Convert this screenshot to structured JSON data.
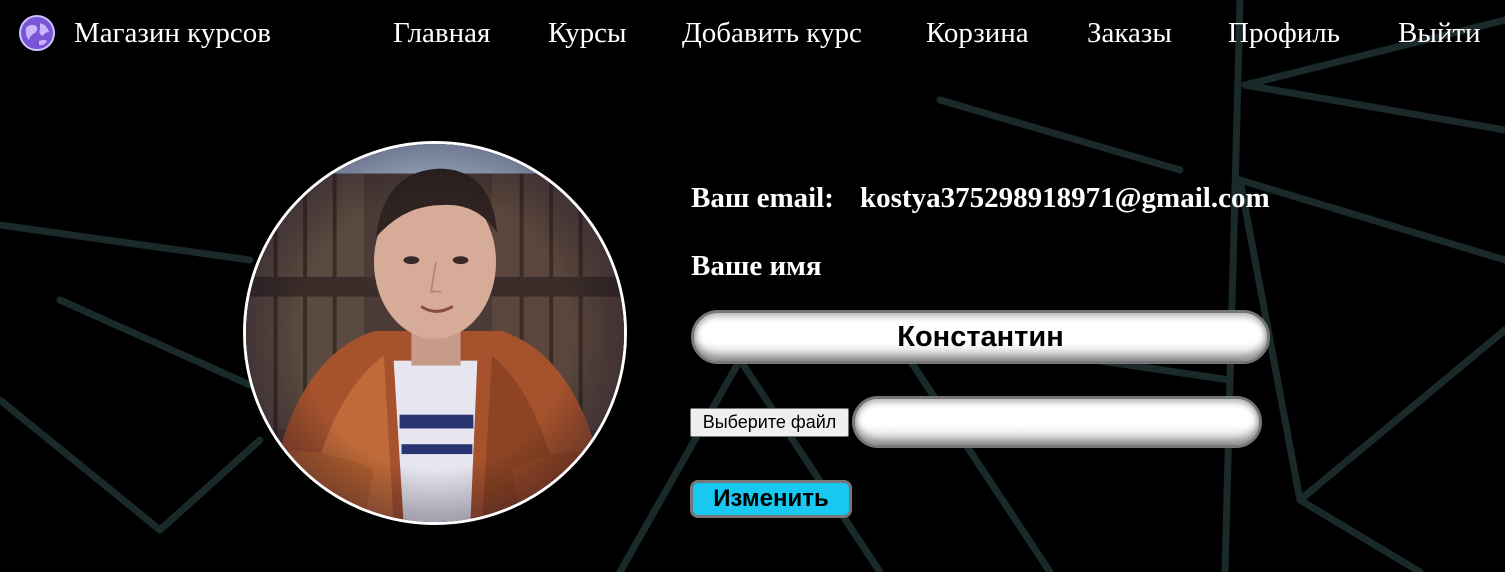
{
  "app": {
    "brand_title": "Магазин курсов",
    "logo_icon": "globe-icon"
  },
  "nav": {
    "items": [
      {
        "label": "Главная"
      },
      {
        "label": "Курсы"
      },
      {
        "label": "Добавить курс"
      },
      {
        "label": "Корзина"
      },
      {
        "label": "Заказы"
      },
      {
        "label": "Профиль"
      },
      {
        "label": "Выйти"
      }
    ]
  },
  "profile": {
    "email_label": "Ваш email:",
    "email_value": "kostya375298918971@gmail.com",
    "name_label": "Ваше имя",
    "name_value": "Константин",
    "file_button_label": "Выберите файл",
    "file_name": "",
    "submit_label": "Изменить",
    "avatar_icon": "user-photo"
  },
  "colors": {
    "background": "#000000",
    "accent_button": "#19c8f0",
    "text": "#ffffff",
    "bg_lines": "#1c2c2c"
  }
}
